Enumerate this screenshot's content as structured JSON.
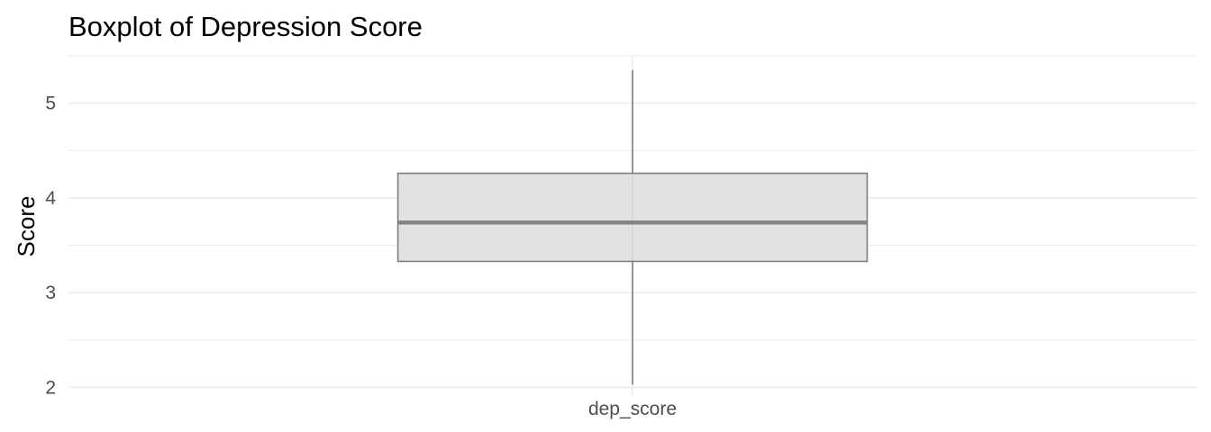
{
  "chart_data": {
    "type": "boxplot",
    "title": "Boxplot of Depression Score",
    "xlabel": "",
    "ylabel": "Score",
    "categories": [
      "dep_score"
    ],
    "boxes": [
      {
        "category": "dep_score",
        "min": 2.03,
        "q1": 3.33,
        "median": 3.74,
        "q3": 4.26,
        "max": 5.35
      }
    ],
    "ylim": [
      1.9,
      5.5
    ],
    "yticks": [
      2,
      3,
      4,
      5
    ],
    "grid": true,
    "colors": {
      "box_fill": "#e0dfe0",
      "box_stroke": "#7f7f7f",
      "median": "#848484",
      "grid": "#ebebeb"
    }
  }
}
